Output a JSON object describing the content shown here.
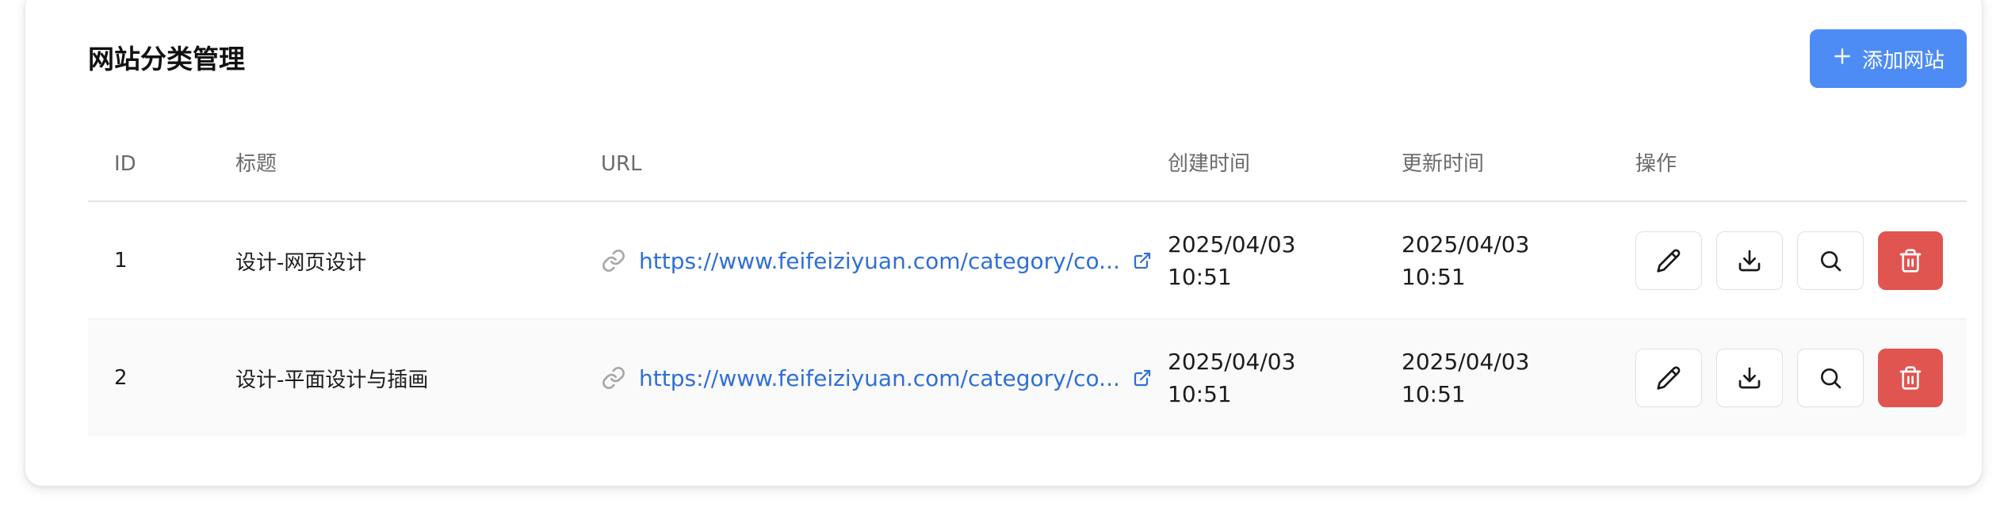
{
  "card": {
    "title": "网站分类管理",
    "add_button_label": "添加网站"
  },
  "table": {
    "headers": {
      "id": "ID",
      "title": "标题",
      "url": "URL",
      "created": "创建时间",
      "updated": "更新时间",
      "actions": "操作"
    },
    "rows": [
      {
        "id": "1",
        "title": "设计-网页设计",
        "url": "https://www.feifeiziyuan.com/category/co...",
        "created_date": "2025/04/03",
        "created_time": "10:51",
        "updated_date": "2025/04/03",
        "updated_time": "10:51"
      },
      {
        "id": "2",
        "title": "设计-平面设计与插画",
        "url": "https://www.feifeiziyuan.com/category/co...",
        "created_date": "2025/04/03",
        "created_time": "10:51",
        "updated_date": "2025/04/03",
        "updated_time": "10:51"
      }
    ]
  },
  "icons": {
    "add": "plus-icon",
    "link": "link-icon",
    "external": "external-link-icon",
    "edit": "pencil-icon",
    "download": "download-icon",
    "search": "search-icon",
    "delete": "trash-icon"
  },
  "colors": {
    "primary": "#4d8cf5",
    "link": "#2f6fd6",
    "danger": "#e15550"
  }
}
